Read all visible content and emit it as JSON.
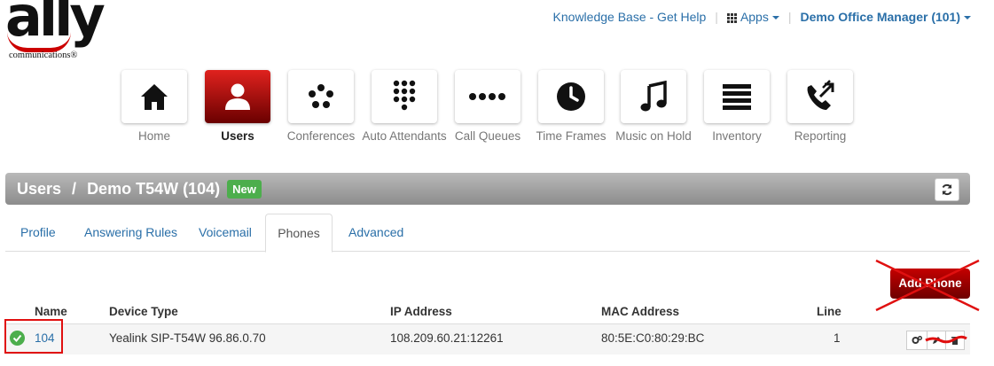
{
  "brand": {
    "logo_text": "ally",
    "logo_sub": "communications",
    "registered": "®",
    "accent": "#cc0000"
  },
  "header_links": {
    "help": "Knowledge Base - Get Help",
    "apps": "Apps",
    "user": "Demo Office Manager (101)"
  },
  "nav": [
    {
      "label": "Home",
      "icon": "house-icon"
    },
    {
      "label": "Users",
      "icon": "user-icon",
      "active": true
    },
    {
      "label": "Conferences",
      "icon": "conference-dots-icon"
    },
    {
      "label": "Auto Attendants",
      "icon": "keypad-icon"
    },
    {
      "label": "Call Queues",
      "icon": "queue-dots-icon"
    },
    {
      "label": "Time Frames",
      "icon": "clock-icon"
    },
    {
      "label": "Music on Hold",
      "icon": "music-note-icon"
    },
    {
      "label": "Inventory",
      "icon": "list-icon"
    },
    {
      "label": "Reporting",
      "icon": "phone-arrows-icon"
    }
  ],
  "title_bar": {
    "section": "Users",
    "separator": "/",
    "subject": "Demo T54W (104)",
    "badge": "New"
  },
  "tabs": [
    {
      "label": "Profile"
    },
    {
      "label": "Answering Rules"
    },
    {
      "label": "Voicemail"
    },
    {
      "label": "Phones",
      "active": true
    },
    {
      "label": "Advanced"
    }
  ],
  "add_button": "Add Phone",
  "table": {
    "headers": {
      "name": "Name",
      "device": "Device Type",
      "ip": "IP Address",
      "mac": "MAC Address",
      "line": "Line"
    },
    "rows": [
      {
        "name": "104",
        "device": "Yealink SIP-T54W 96.86.0.70",
        "ip": "108.209.60.21:12261",
        "mac": "80:5E:C0:80:29:BC",
        "line": "1",
        "status": "ok"
      }
    ]
  }
}
